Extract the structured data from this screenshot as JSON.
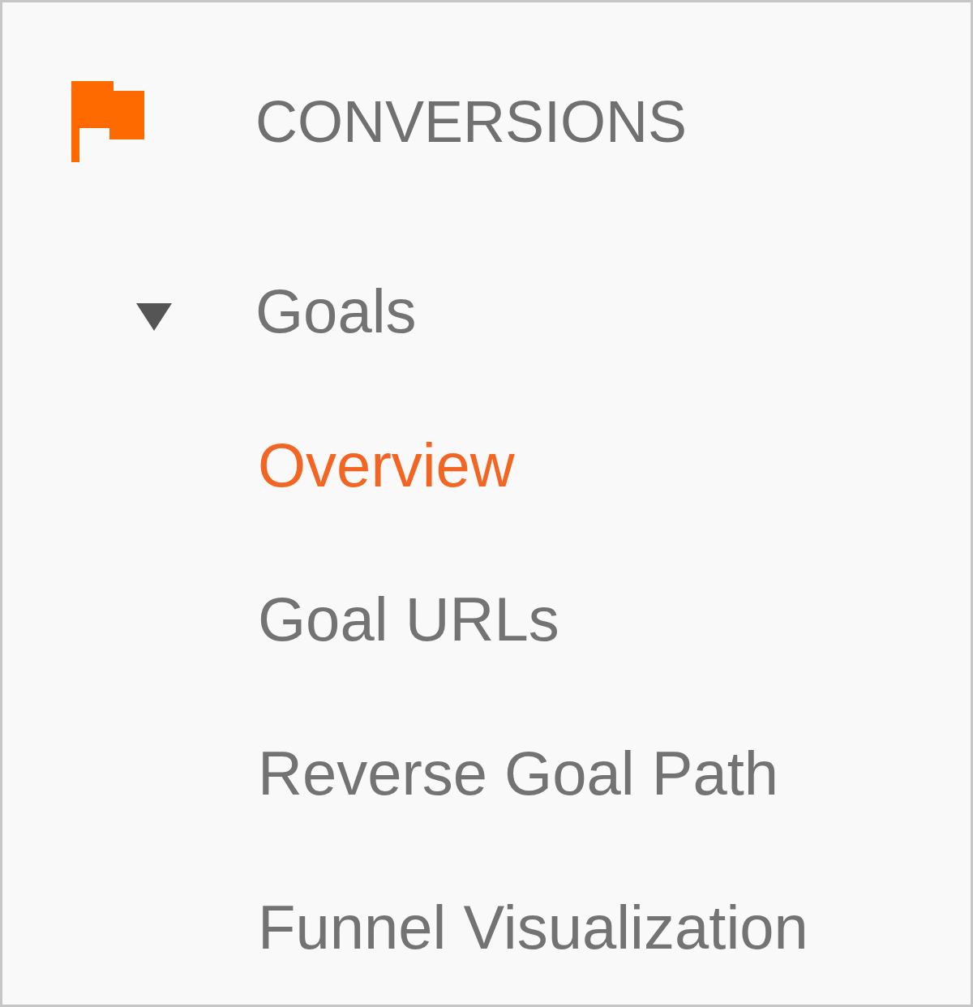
{
  "section": {
    "title": "CONVERSIONS"
  },
  "nav": [
    {
      "label": "Goals",
      "expanded": true,
      "children": [
        {
          "label": "Overview",
          "selected": true
        },
        {
          "label": "Goal URLs",
          "selected": false
        },
        {
          "label": "Reverse Goal Path",
          "selected": false
        },
        {
          "label": "Funnel Visualization",
          "selected": false
        }
      ]
    }
  ]
}
